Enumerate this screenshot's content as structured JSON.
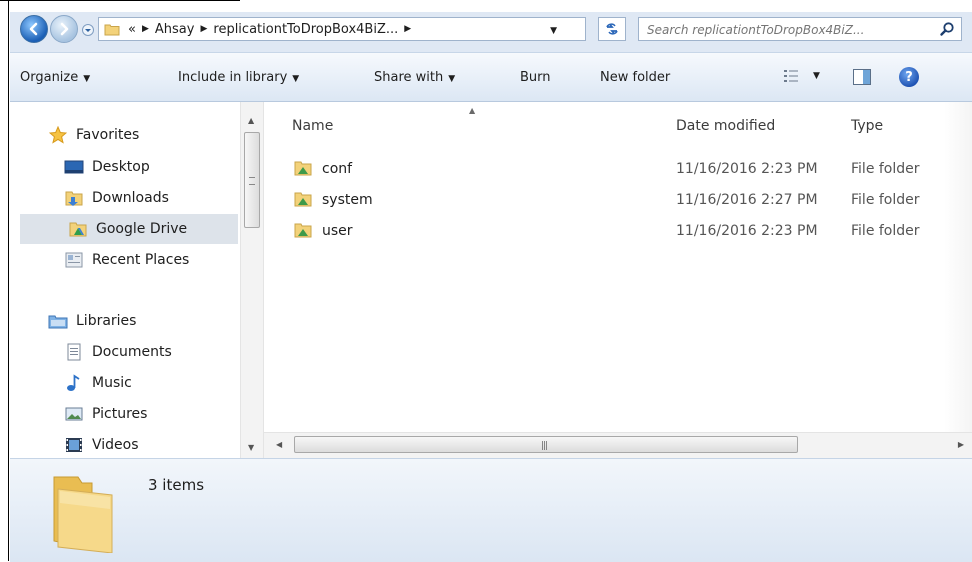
{
  "window": {
    "address": {
      "crumbs": [
        "Ahsay",
        "replicationtToDropBox4BiZ..."
      ],
      "overflow_glyph": "«"
    },
    "search": {
      "placeholder": "Search replicationtToDropBox4BiZ..."
    }
  },
  "toolbar": {
    "organize": "Organize",
    "include_in_library": "Include in library",
    "share_with": "Share with",
    "burn": "Burn",
    "new_folder": "New folder"
  },
  "navigation": {
    "favorites": {
      "label": "Favorites",
      "items": [
        {
          "label": "Desktop",
          "icon": "desktop-icon"
        },
        {
          "label": "Downloads",
          "icon": "downloads-folder-icon"
        },
        {
          "label": "Google Drive",
          "icon": "google-drive-folder-icon",
          "selected": true
        },
        {
          "label": "Recent Places",
          "icon": "recent-places-icon"
        }
      ]
    },
    "libraries": {
      "label": "Libraries",
      "items": [
        {
          "label": "Documents",
          "icon": "documents-icon"
        },
        {
          "label": "Music",
          "icon": "music-icon"
        },
        {
          "label": "Pictures",
          "icon": "pictures-icon"
        },
        {
          "label": "Videos",
          "icon": "videos-icon"
        }
      ]
    }
  },
  "file_list": {
    "columns": [
      "Name",
      "Date modified",
      "Type"
    ],
    "sorted_by": "Name",
    "rows": [
      {
        "name": "conf",
        "date": "11/16/2016 2:23 PM",
        "type": "File folder"
      },
      {
        "name": "system",
        "date": "11/16/2016 2:27 PM",
        "type": "File folder"
      },
      {
        "name": "user",
        "date": "11/16/2016 2:23 PM",
        "type": "File folder"
      }
    ]
  },
  "details": {
    "item_count": "3 items"
  },
  "colors": {
    "chrome_bg": "#dfe8f4",
    "toolbar_top": "#f6f9fd",
    "toolbar_bottom": "#dce7f4",
    "selected_nav": "#dde3ea",
    "folder_yellow": "#f3d27a"
  }
}
